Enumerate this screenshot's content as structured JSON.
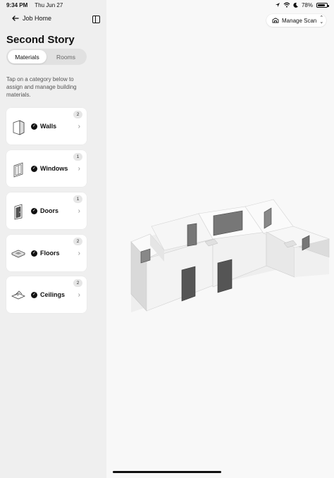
{
  "status_bar": {
    "time": "9:34 PM",
    "date": "Thu Jun 27",
    "battery": "78%",
    "icons": [
      "location-icon",
      "wifi-icon",
      "moon-icon",
      "battery-icon"
    ]
  },
  "header": {
    "back_label": "Job Home",
    "title": "Second Story"
  },
  "tabs": [
    {
      "label": "Materials",
      "active": true
    },
    {
      "label": "Rooms",
      "active": false
    }
  ],
  "instructions": "Tap on a category below to assign and manage building materials.",
  "categories": [
    {
      "label": "Walls",
      "count": "2",
      "icon": "wall-icon"
    },
    {
      "label": "Windows",
      "count": "1",
      "icon": "window-icon"
    },
    {
      "label": "Doors",
      "count": "1",
      "icon": "door-icon"
    },
    {
      "label": "Floors",
      "count": "2",
      "icon": "floor-icon"
    },
    {
      "label": "Ceilings",
      "count": "2",
      "icon": "ceiling-icon"
    }
  ],
  "toolbar": {
    "manage_scan_label": "Manage Scan"
  }
}
